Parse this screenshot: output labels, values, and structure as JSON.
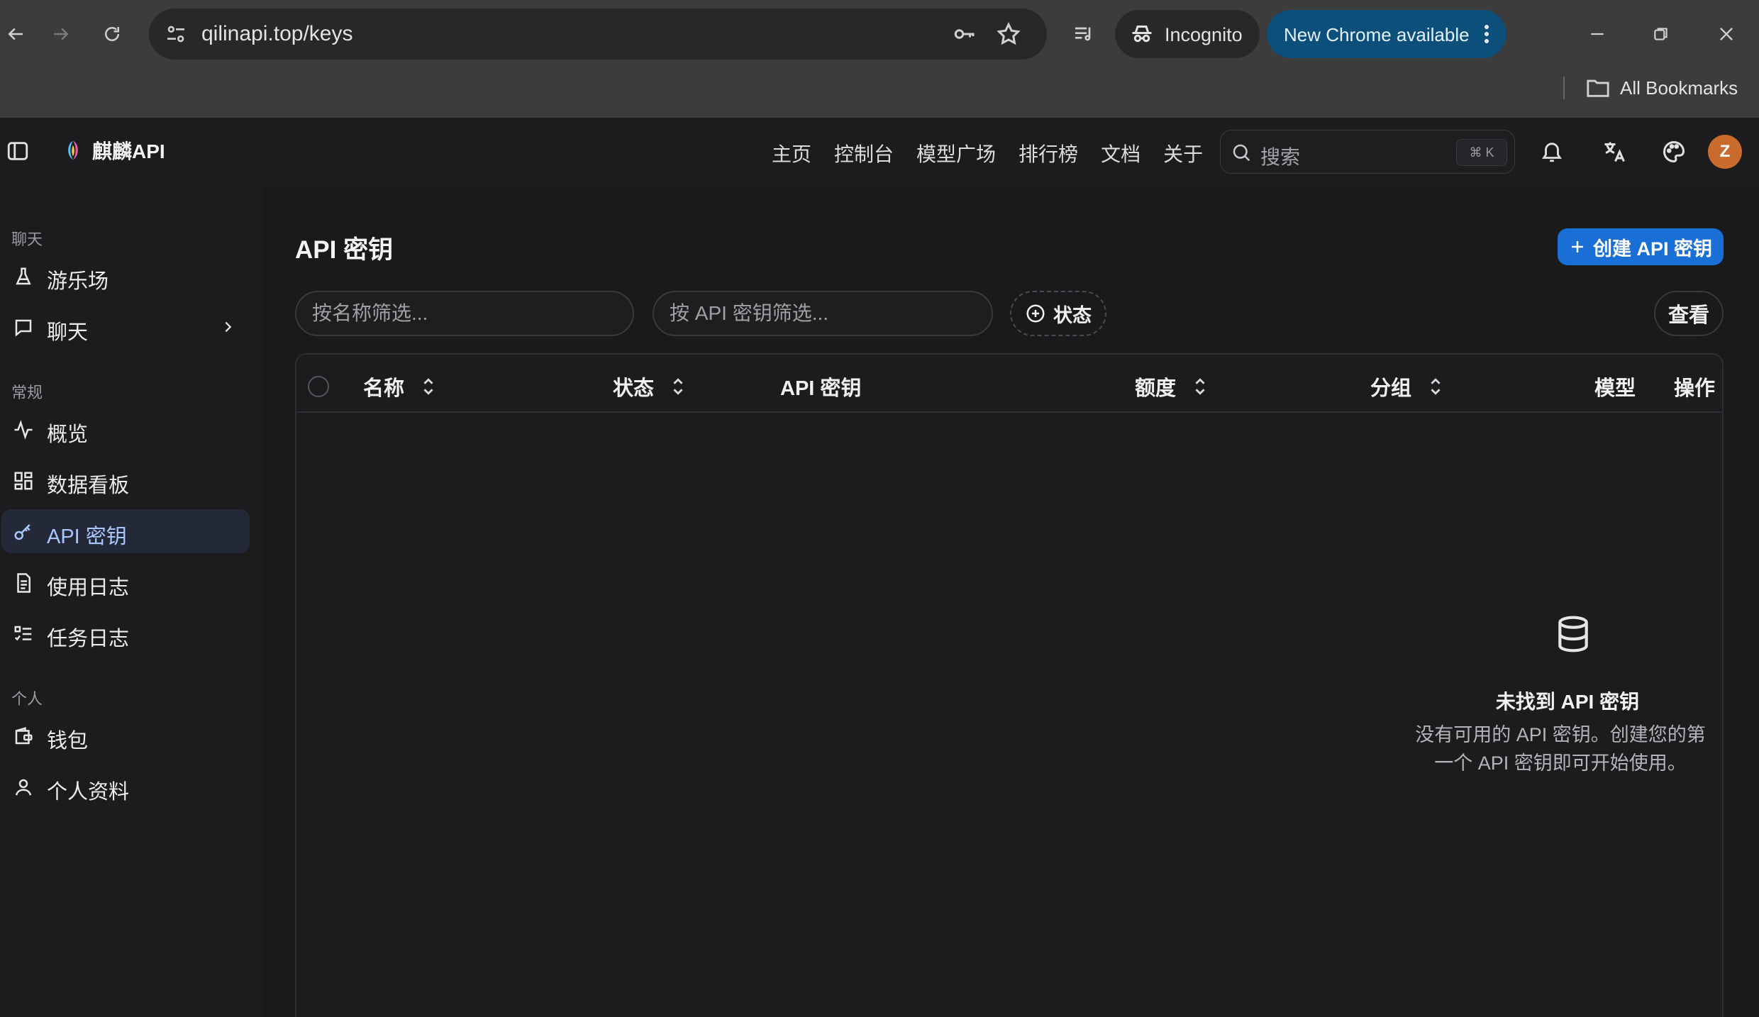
{
  "browser": {
    "url": "qilinapi.top/keys",
    "incognito_label": "Incognito",
    "update_label": "New Chrome available",
    "bookmarks_label": "All Bookmarks"
  },
  "header": {
    "brand": "麒麟API",
    "nav": [
      "主页",
      "控制台",
      "模型广场",
      "排行榜",
      "文档",
      "关于"
    ],
    "search_placeholder": "搜索",
    "search_kbd": "⌘ K",
    "avatar_letter": "Z"
  },
  "sidebar": {
    "groups": [
      "聊天",
      "常规",
      "个人"
    ],
    "items": [
      {
        "label": "游乐场",
        "icon": "flask-icon"
      },
      {
        "label": "聊天",
        "icon": "chat-icon"
      },
      {
        "label": "概览",
        "icon": "activity-icon"
      },
      {
        "label": "数据看板",
        "icon": "dashboard-icon"
      },
      {
        "label": "API 密钥",
        "icon": "key-icon",
        "active": true
      },
      {
        "label": "使用日志",
        "icon": "document-icon"
      },
      {
        "label": "任务日志",
        "icon": "checklist-icon"
      },
      {
        "label": "钱包",
        "icon": "wallet-icon"
      },
      {
        "label": "个人资料",
        "icon": "user-icon"
      }
    ]
  },
  "main": {
    "title": "API 密钥",
    "create_label": "创建 API 密钥",
    "filter_name_placeholder": "按名称筛选...",
    "filter_key_placeholder": "按 API 密钥筛选...",
    "status_filter_label": "状态",
    "view_label": "查看",
    "columns": [
      "名称",
      "状态",
      "API 密钥",
      "额度",
      "分组",
      "模型",
      "操作"
    ],
    "empty_title": "未找到 API 密钥",
    "empty_desc": "没有可用的 API 密钥。创建您的第一个 API 密钥即可开始使用。"
  },
  "colors": {
    "accent": "#1a6fd6",
    "active_nav_bg": "#24293a",
    "avatar": "#c96b2c",
    "update_chip": "#0b4f7a"
  }
}
